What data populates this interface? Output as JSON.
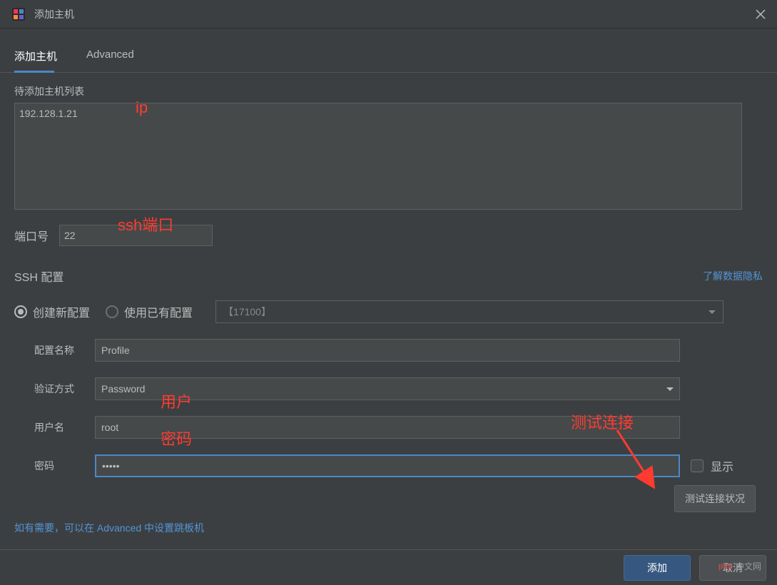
{
  "window": {
    "title": "添加主机"
  },
  "tabs": {
    "add_host": "添加主机",
    "advanced": "Advanced"
  },
  "hostlist": {
    "label": "待添加主机列表",
    "value": "192.128.1.21"
  },
  "port": {
    "label": "端口号",
    "value": "22"
  },
  "ssh": {
    "label": "SSH 配置",
    "privacy_link": "了解数据隐私",
    "radio_create": "创建新配置",
    "radio_existing": "使用已有配置",
    "existing_value": "【17100】",
    "profile_label": "配置名称",
    "profile_value": "Profile",
    "auth_label": "验证方式",
    "auth_value": "Password",
    "user_label": "用户名",
    "user_value": "root",
    "password_label": "密码",
    "password_value": "•••••",
    "show_label": "显示"
  },
  "annotations": {
    "ip": "ip",
    "ssh_port": "ssh端口",
    "user": "用户",
    "password": "密码",
    "test_conn": "测试连接"
  },
  "buttons": {
    "test": "测试连接状况",
    "add": "添加",
    "cancel": "取消"
  },
  "hint": "如有需要，可以在 Advanced 中设置跳板机",
  "watermark": "中文网"
}
